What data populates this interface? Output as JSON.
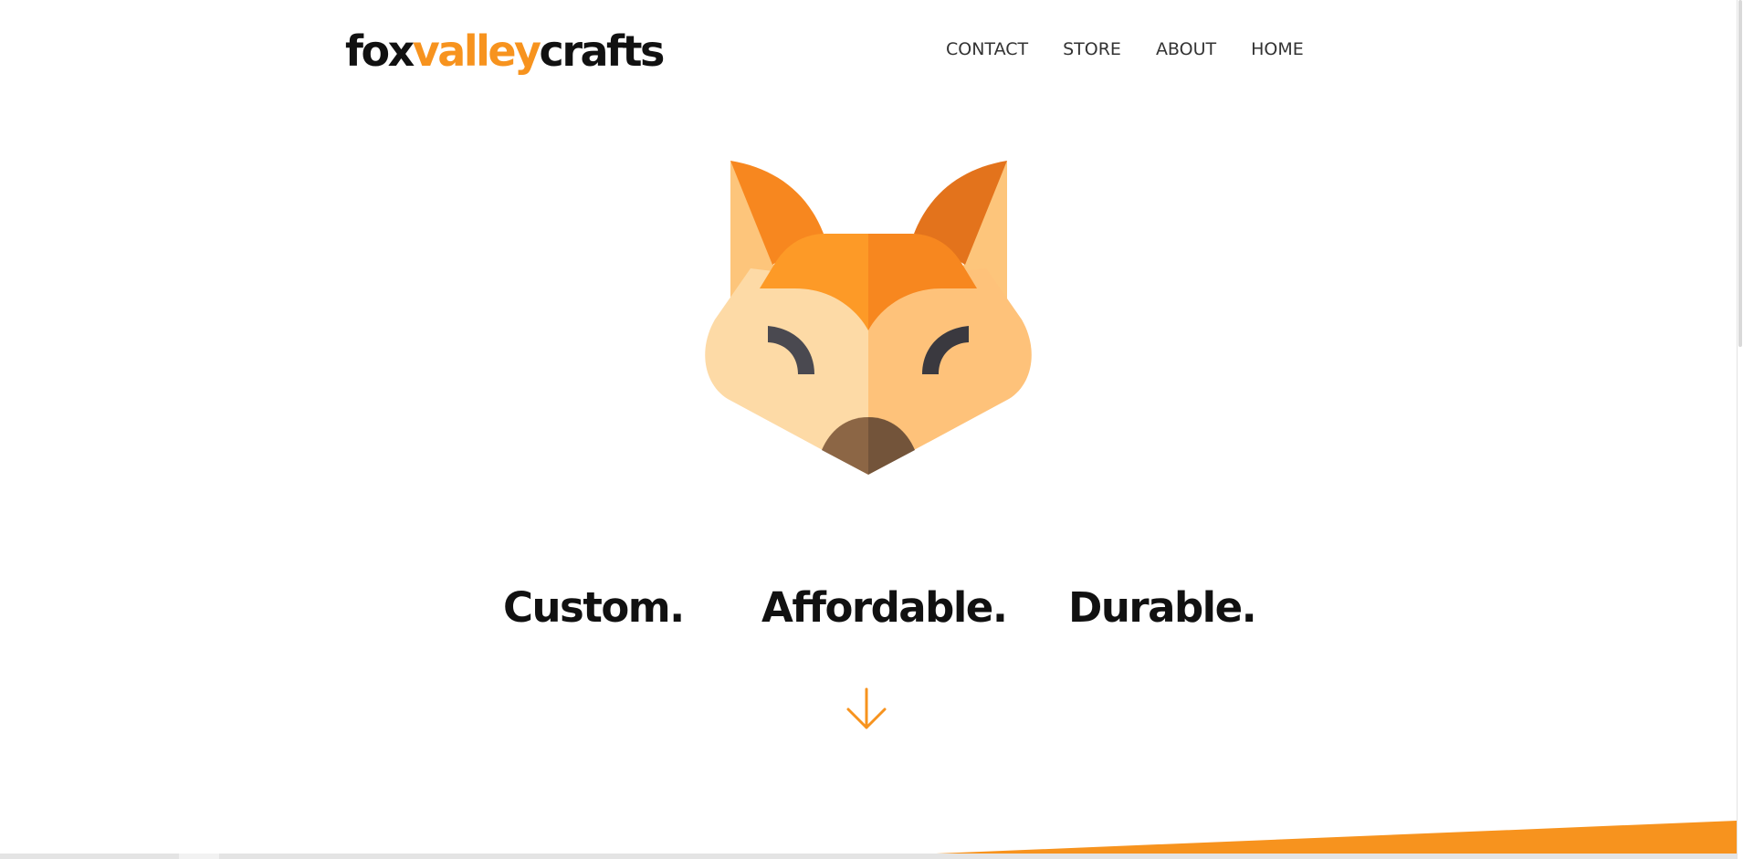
{
  "header": {
    "logo": {
      "part1": "fox",
      "part2": "valley",
      "part3": "crafts"
    },
    "nav": [
      {
        "label": "CONTACT"
      },
      {
        "label": "STORE"
      },
      {
        "label": "ABOUT"
      },
      {
        "label": "HOME"
      }
    ]
  },
  "hero": {
    "image": "fox-head-logo",
    "taglines": [
      "Custom.",
      "Affordable.",
      "Durable."
    ],
    "scroll_icon": "arrow-down-icon"
  },
  "colors": {
    "accent": "#f7931e",
    "text": "#111111",
    "nav_text": "#333333",
    "background": "#ffffff"
  }
}
